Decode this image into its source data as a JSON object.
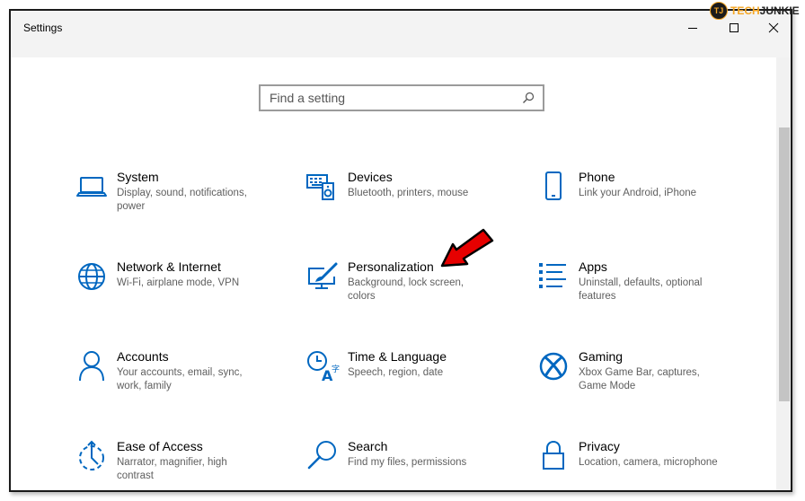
{
  "window": {
    "title": "Settings"
  },
  "search": {
    "placeholder": "Find a setting"
  },
  "watermark": {
    "badge": "TJ",
    "tech": "TECH",
    "junkie": "JUNKIE"
  },
  "colors": {
    "accent": "#0067c0",
    "arrow": "#e60000"
  },
  "categories": [
    {
      "name": "System",
      "desc": "Display, sound, notifications, power",
      "icon": "laptop-icon"
    },
    {
      "name": "Devices",
      "desc": "Bluetooth, printers, mouse",
      "icon": "keyboard-speaker-icon"
    },
    {
      "name": "Phone",
      "desc": "Link your Android, iPhone",
      "icon": "phone-icon"
    },
    {
      "name": "Network & Internet",
      "desc": "Wi-Fi, airplane mode, VPN",
      "icon": "globe-icon"
    },
    {
      "name": "Personalization",
      "desc": "Background, lock screen, colors",
      "icon": "paintbrush-monitor-icon"
    },
    {
      "name": "Apps",
      "desc": "Uninstall, defaults, optional features",
      "icon": "apps-list-icon"
    },
    {
      "name": "Accounts",
      "desc": "Your accounts, email, sync, work, family",
      "icon": "person-icon"
    },
    {
      "name": "Time & Language",
      "desc": "Speech, region, date",
      "icon": "time-language-icon"
    },
    {
      "name": "Gaming",
      "desc": "Xbox Game Bar, captures, Game Mode",
      "icon": "xbox-icon"
    },
    {
      "name": "Ease of Access",
      "desc": "Narrator, magnifier, high contrast",
      "icon": "ease-of-access-icon"
    },
    {
      "name": "Search",
      "desc": "Find my files, permissions",
      "icon": "magnifier-icon"
    },
    {
      "name": "Privacy",
      "desc": "Location, camera, microphone",
      "icon": "lock-icon"
    }
  ]
}
